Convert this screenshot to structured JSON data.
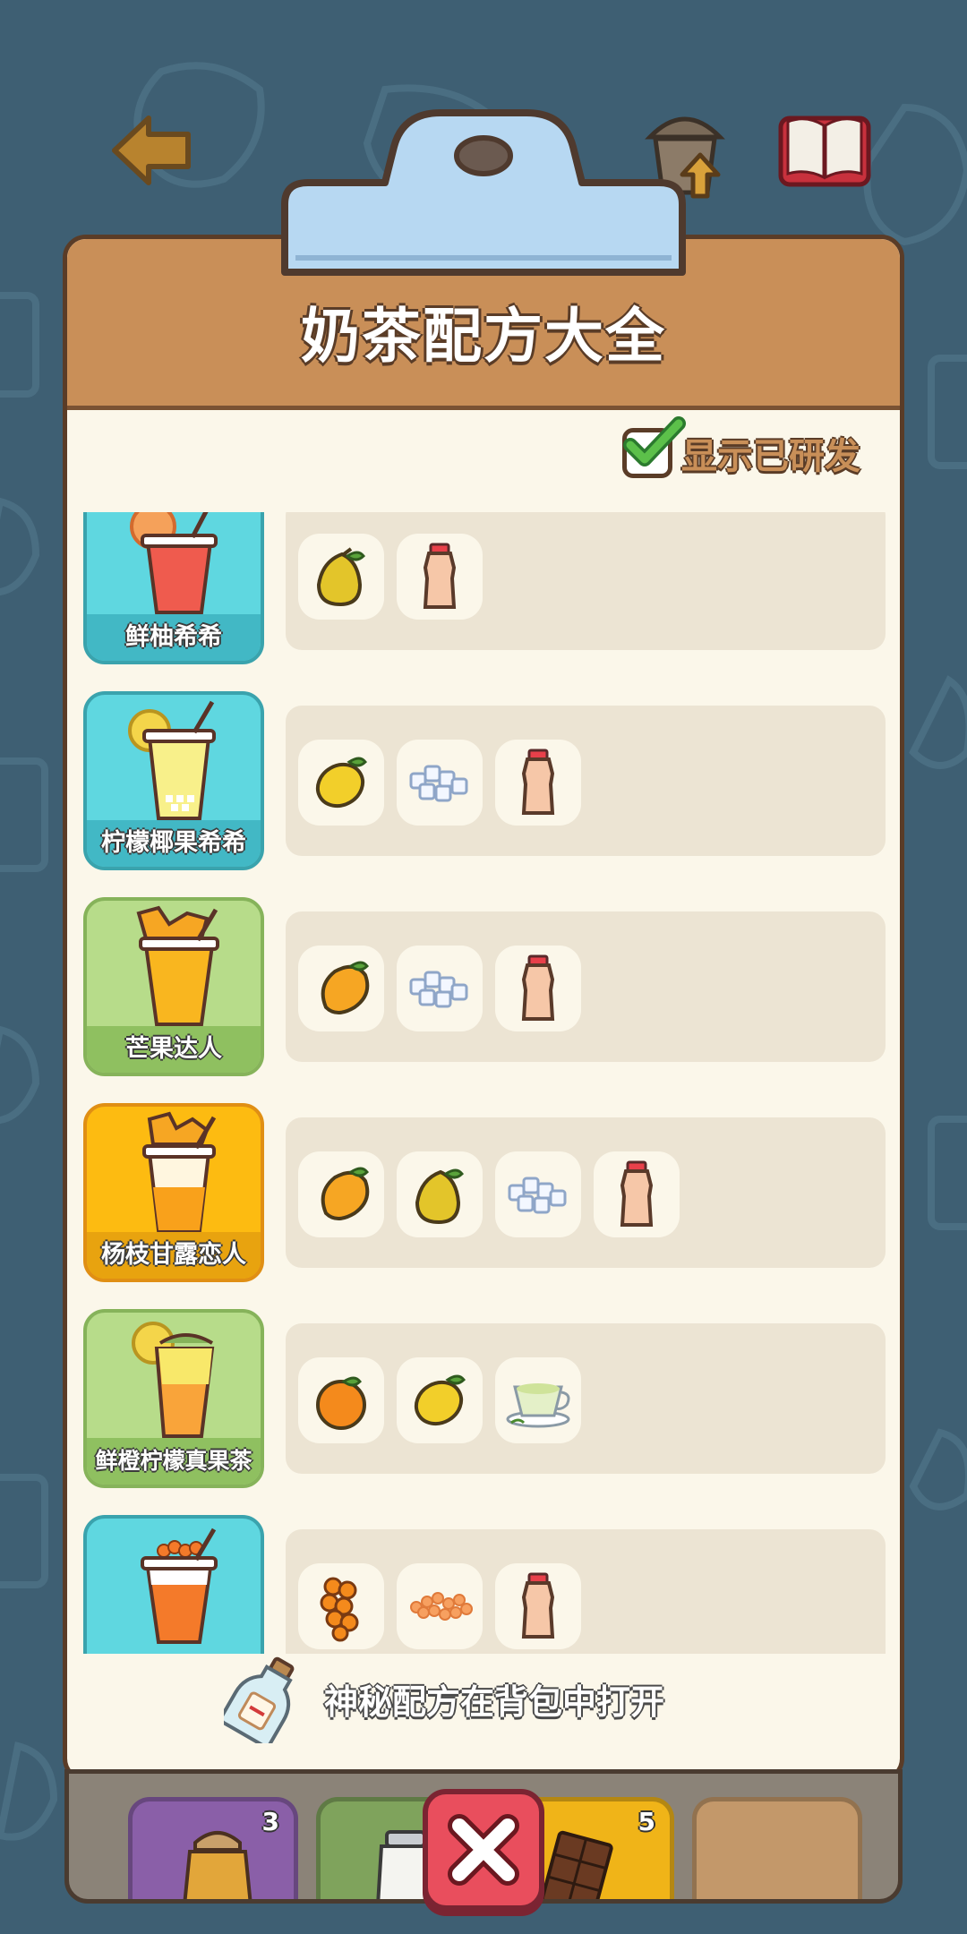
{
  "header": {
    "title": "奶茶配方大全"
  },
  "filter": {
    "label": "显示已研发",
    "checked": true
  },
  "recipes": [
    {
      "name": "鲜柚希希",
      "ingredients": [
        "pear-icon",
        "yakult-bottle-icon"
      ]
    },
    {
      "name": "柠檬椰果希希",
      "ingredients": [
        "lemon-icon",
        "coconut-jelly-icon",
        "yakult-bottle-icon"
      ]
    },
    {
      "name": "芒果达人",
      "ingredients": [
        "mango-icon",
        "coconut-jelly-icon",
        "yakult-bottle-icon"
      ]
    },
    {
      "name": "杨枝甘露恋人",
      "ingredients": [
        "mango-icon",
        "pear-icon",
        "coconut-jelly-icon",
        "yakult-bottle-icon"
      ]
    },
    {
      "name": "鲜橙柠檬真果茶",
      "ingredients": [
        "orange-icon",
        "lemon-icon",
        "green-tea-icon"
      ]
    },
    {
      "name": "",
      "ingredients": [
        "sea-buckthorn-icon",
        "orange-pearls-icon",
        "yakult-bottle-icon"
      ]
    }
  ],
  "footer": {
    "note": "神秘配方在背包中打开"
  },
  "inventory": [
    {
      "item": "honey-jar-icon",
      "count": "3"
    },
    {
      "item": "milk-jar-icon",
      "count": ""
    },
    {
      "item": "chocolate-icon",
      "count": "5"
    },
    {
      "item": "empty-slot",
      "count": ""
    }
  ],
  "colors": {
    "background": "#3e5f73",
    "board_header": "#c98f58",
    "board_body": "#fbf7ea",
    "close_button": "#e94e5d"
  }
}
